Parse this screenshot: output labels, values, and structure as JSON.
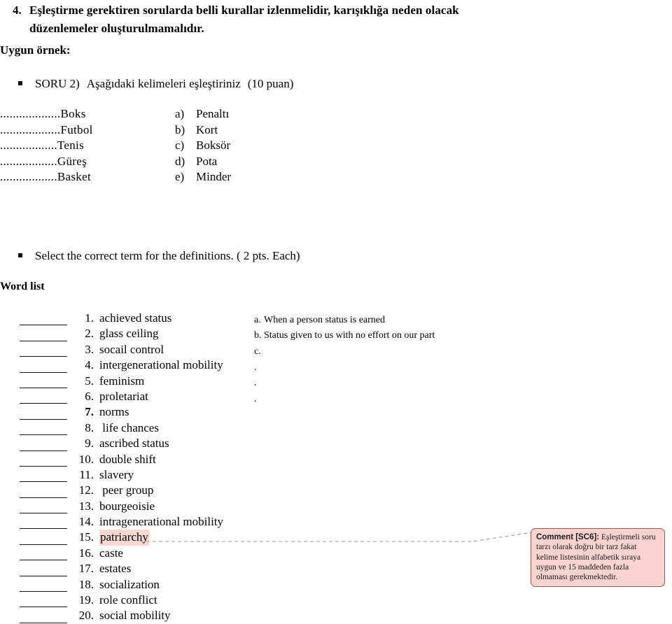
{
  "rule": {
    "number": "4.",
    "text": "Eşleştirme gerektiren sorularda belli kurallar izlenmelidir, karışıklığa neden olacak düzenlemeler oluşturulmamalıdır."
  },
  "example_heading": "Uygun örnek:",
  "soru2": {
    "label": "SORU 2)",
    "text": "Aşağıdaki kelimeleri eşleştiriniz",
    "points": "(10 puan)"
  },
  "matching_example": {
    "left": [
      "...................Boks",
      "...................Futbol",
      "..................Tenis",
      "..................Güreş",
      "..................Basket"
    ],
    "right": [
      {
        "letter": "a)",
        "term": "Penaltı"
      },
      {
        "letter": "b)",
        "term": "Kort"
      },
      {
        "letter": "c)",
        "term": "Boksör"
      },
      {
        "letter": "d)",
        "term": "Pota"
      },
      {
        "letter": "e)",
        "term": "Minder"
      }
    ]
  },
  "select_prompt": "Select the correct term for the definitions. ( 2 pts. Each)",
  "word_list_heading": "Word list",
  "word_list": [
    {
      "num": "1.",
      "term": "achieved status",
      "bold": false,
      "highlight": false
    },
    {
      "num": "2.",
      "term": "glass ceiling",
      "bold": false,
      "highlight": false
    },
    {
      "num": "3.",
      "term": "socail control",
      "bold": false,
      "highlight": false
    },
    {
      "num": "4.",
      "term": "intergenerational mobility",
      "bold": false,
      "highlight": false
    },
    {
      "num": "5.",
      "term": "feminism",
      "bold": false,
      "highlight": false
    },
    {
      "num": "6.",
      "term": "proletariat",
      "bold": false,
      "highlight": false
    },
    {
      "num": "7.",
      "term": "norms",
      "bold": true,
      "highlight": false
    },
    {
      "num": "8.",
      "term": " life chances",
      "bold": false,
      "highlight": false
    },
    {
      "num": "9.",
      "term": "ascribed status",
      "bold": false,
      "highlight": false
    },
    {
      "num": "10.",
      "term": "double shift",
      "bold": false,
      "highlight": false
    },
    {
      "num": "11.",
      "term": "slavery",
      "bold": false,
      "highlight": false
    },
    {
      "num": "12.",
      "term": " peer group",
      "bold": false,
      "highlight": false
    },
    {
      "num": "13.",
      "term": "bourgeoisie",
      "bold": false,
      "highlight": false
    },
    {
      "num": "14.",
      "term": "intragenerational mobility",
      "bold": false,
      "highlight": false
    },
    {
      "num": "15.",
      "term": "patriarchy",
      "bold": false,
      "highlight": true
    },
    {
      "num": "16.",
      "term": "caste",
      "bold": false,
      "highlight": false
    },
    {
      "num": "17.",
      "term": "estates",
      "bold": false,
      "highlight": false
    },
    {
      "num": "18.",
      "term": "socialization",
      "bold": false,
      "highlight": false
    },
    {
      "num": "19.",
      "term": "role conflict",
      "bold": false,
      "highlight": false
    },
    {
      "num": "20.",
      "term": "social mobility",
      "bold": false,
      "highlight": false
    }
  ],
  "definitions": [
    {
      "letter": "a.",
      "text": "When a person status is earned"
    },
    {
      "letter": "b.",
      "text": "Status given to us with no effort on our part"
    },
    {
      "letter": "c.",
      "text": ""
    },
    {
      "letter": ".",
      "text": ""
    },
    {
      "letter": ".",
      "text": ""
    },
    {
      "letter": ".",
      "text": ""
    }
  ],
  "comment": {
    "label": "Comment [SC6]:",
    "text": " Eşleştirmeli soru tarzı olarak doğru bir tarz fakat kelime listesinin alfabetik sıraya uygun ve 15 maddeden fazla olmaması gerekmektedir."
  },
  "colors": {
    "highlight": "#f9d8d4",
    "comment_bg": "#f8d3cf",
    "comment_border": "#9d5a52",
    "leader_line": "#9a9a9a"
  }
}
